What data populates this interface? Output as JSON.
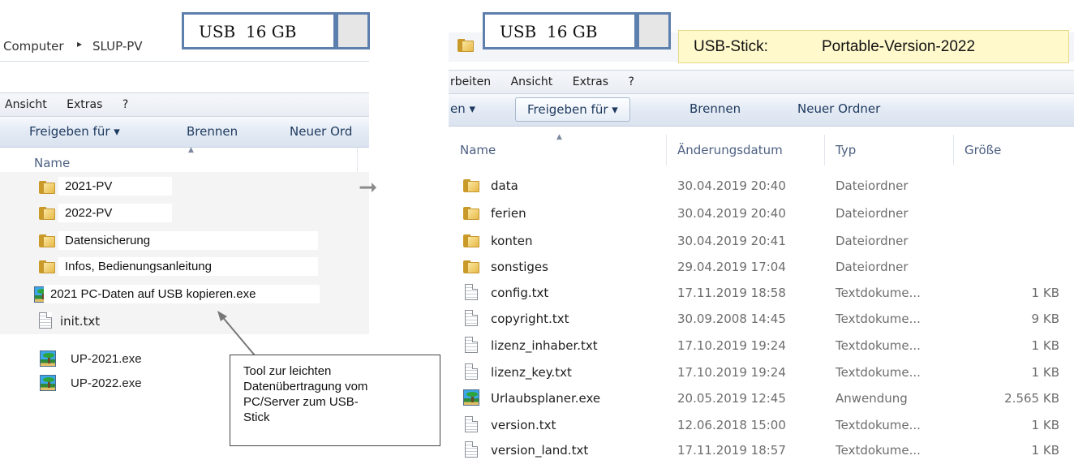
{
  "left_window": {
    "breadcrumb_root": "Computer",
    "breadcrumb_sep": "▸",
    "breadcrumb_folder": "SLUP-PV",
    "menu": [
      "Ansicht",
      "Extras",
      "?"
    ],
    "toolbar": {
      "share": "Freigeben für ▾",
      "burn": "Brennen",
      "new_folder": "Neuer Ord"
    },
    "column_name": "Name",
    "items": [
      {
        "name": "2021-PV",
        "icon": "folder-icon"
      },
      {
        "name": "2022-PV",
        "icon": "folder-icon"
      },
      {
        "name": "Datensicherung",
        "icon": "folder-icon"
      },
      {
        "name": "Infos, Bedienungsanleitung",
        "icon": "folder-icon"
      },
      {
        "name": "2021 PC-Daten auf USB kopieren.exe",
        "icon": "app-icon"
      },
      {
        "name": "init.txt",
        "icon": "text-file-icon"
      }
    ],
    "desktop_items": [
      "UP-2021.exe",
      "UP-2022.exe"
    ]
  },
  "right_window": {
    "menu": [
      "rbeiten",
      "Ansicht",
      "Extras",
      "?"
    ],
    "toolbar": {
      "organize": "en ▾",
      "share": "Freigeben für ▾",
      "burn": "Brennen",
      "new_folder": "Neuer Ordner"
    },
    "columns": [
      "Name",
      "Änderungsdatum",
      "Typ",
      "Größe"
    ],
    "files": [
      {
        "name": "data",
        "date": "30.04.2019 20:40",
        "type": "Dateiordner",
        "size": "",
        "icon": "folder-icon"
      },
      {
        "name": "ferien",
        "date": "30.04.2019 20:40",
        "type": "Dateiordner",
        "size": "",
        "icon": "folder-icon"
      },
      {
        "name": "konten",
        "date": "30.04.2019 20:41",
        "type": "Dateiordner",
        "size": "",
        "icon": "folder-icon"
      },
      {
        "name": "sonstiges",
        "date": "29.04.2019 17:04",
        "type": "Dateiordner",
        "size": "",
        "icon": "folder-icon"
      },
      {
        "name": "config.txt",
        "date": "17.11.2019 18:58",
        "type": "Textdokume...",
        "size": "1 KB",
        "icon": "text-file-icon"
      },
      {
        "name": "copyright.txt",
        "date": "30.09.2008 14:45",
        "type": "Textdokume...",
        "size": "9 KB",
        "icon": "text-file-icon"
      },
      {
        "name": "lizenz_inhaber.txt",
        "date": "17.10.2019 19:24",
        "type": "Textdokume...",
        "size": "1 KB",
        "icon": "text-file-icon"
      },
      {
        "name": "lizenz_key.txt",
        "date": "17.10.2019 19:24",
        "type": "Textdokume...",
        "size": "1 KB",
        "icon": "text-file-icon"
      },
      {
        "name": "Urlaubsplaner.exe",
        "date": "20.05.2019 12:45",
        "type": "Anwendung",
        "size": "2.565 KB",
        "icon": "app-icon"
      },
      {
        "name": "version.txt",
        "date": "12.06.2018 15:00",
        "type": "Textdokume...",
        "size": "1 KB",
        "icon": "text-file-icon"
      },
      {
        "name": "version_land.txt",
        "date": "17.11.2019 18:57",
        "type": "Textdokume...",
        "size": "1 KB",
        "icon": "text-file-icon"
      }
    ]
  },
  "annotations": {
    "usb_label": "USB  16 GB",
    "usb_stick_label": "USB-Stick:",
    "usb_stick_version": "Portable-Version-2022",
    "callout_lines": [
      "Tool zur leichten",
      "Datenübertragung vom",
      "PC/Server zum USB-",
      "Stick"
    ],
    "arrow_glyph": "➞"
  },
  "colors": {
    "usb_box_border": "#5d7fae",
    "yellow_note_bg": "#fff9cc",
    "toolbar_text": "#1e3a5f"
  }
}
